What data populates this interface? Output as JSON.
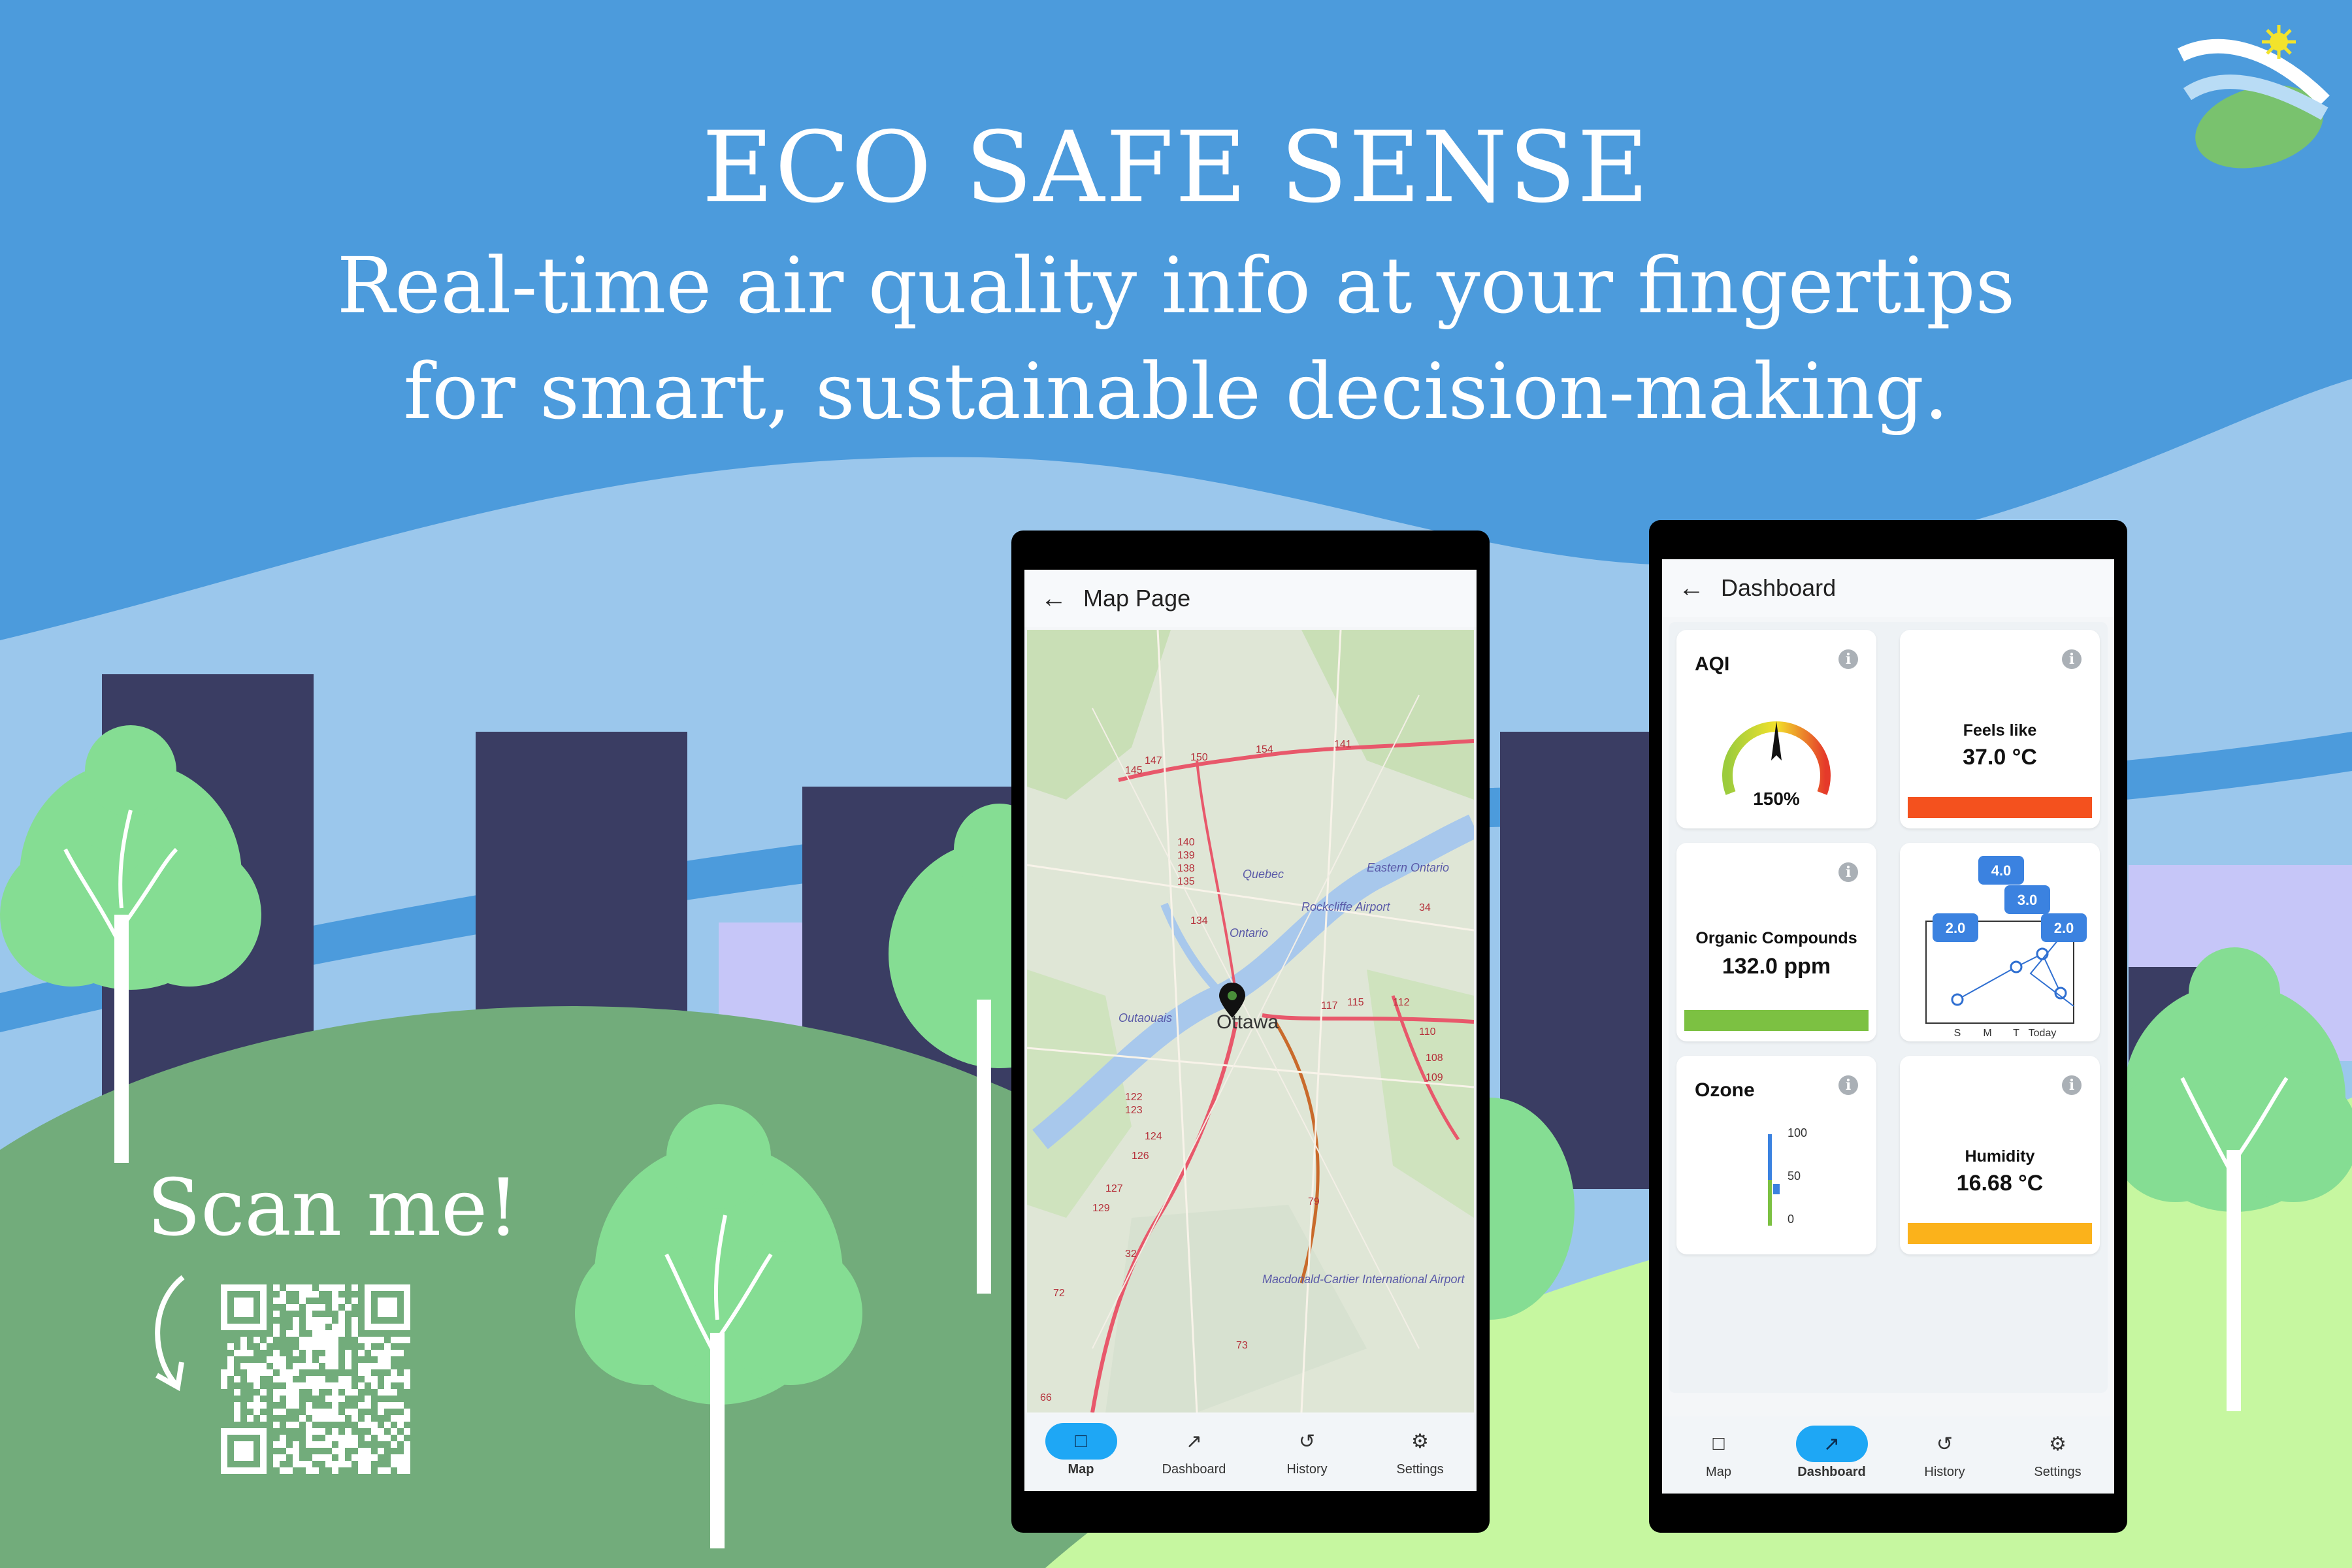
{
  "brand": {
    "title": "ECO SAFE SENSE",
    "tagline_line1": "Real-time air quality info at your fingertips",
    "tagline_line2": "for smart, sustainable decision-making.",
    "scan_label": "Scan me!"
  },
  "colors": {
    "sky": "#4c9bdc",
    "building": "#3a3d63",
    "hill_dark": "#72ac7b",
    "hill_light": "#c6f7a0",
    "tree": "#85dd93",
    "accent_blue": "#1ea7f5"
  },
  "map_screen": {
    "title": "Map Page",
    "back_icon": "arrow-left-icon",
    "city_label": "Ottawa",
    "map_labels": [
      "Rockcliffe Airport",
      "Macdonald-Cartier International Airport",
      "Eastern Ontario",
      "Quebec",
      "Outaouais",
      "Ontario"
    ],
    "road_numbers": [
      "145",
      "147",
      "150",
      "154",
      "141",
      "140",
      "139",
      "138",
      "135",
      "134",
      "34",
      "117",
      "115",
      "112",
      "110",
      "108",
      "109",
      "122",
      "123",
      "124",
      "126",
      "127",
      "129",
      "79",
      "32",
      "73",
      "66",
      "72"
    ],
    "nav": [
      {
        "label": "Map",
        "icon": "map-icon",
        "active": true
      },
      {
        "label": "Dashboard",
        "icon": "trend-icon",
        "active": false
      },
      {
        "label": "History",
        "icon": "history-icon",
        "active": false
      },
      {
        "label": "Settings",
        "icon": "gear-icon",
        "active": false
      }
    ]
  },
  "dashboard_screen": {
    "title": "Dashboard",
    "back_icon": "arrow-left-icon",
    "aqi": {
      "title": "AQI",
      "value": "150%",
      "level": 0.5
    },
    "feels_like": {
      "label": "Feels like",
      "value": "37.0 °C",
      "bar_color": "#f4511e"
    },
    "organic": {
      "label": "Organic Compounds",
      "value": "132.0 ppm",
      "bar_color": "#7cc142"
    },
    "trend": {
      "values": [
        "4.0",
        "3.0",
        "2.0",
        "2.0"
      ],
      "x_labels": [
        "S",
        "M",
        "T",
        "Today"
      ]
    },
    "ozone": {
      "title": "Ozone",
      "ticks": [
        "100",
        "50",
        "0"
      ],
      "level": 0.4
    },
    "humidity": {
      "label": "Humidity",
      "value": "16.68 °C",
      "bar_color": "#fbb21b"
    },
    "nav": [
      {
        "label": "Map",
        "icon": "map-icon",
        "active": false
      },
      {
        "label": "Dashboard",
        "icon": "trend-icon",
        "active": true
      },
      {
        "label": "History",
        "icon": "history-icon",
        "active": false
      },
      {
        "label": "Settings",
        "icon": "gear-icon",
        "active": false
      }
    ]
  }
}
